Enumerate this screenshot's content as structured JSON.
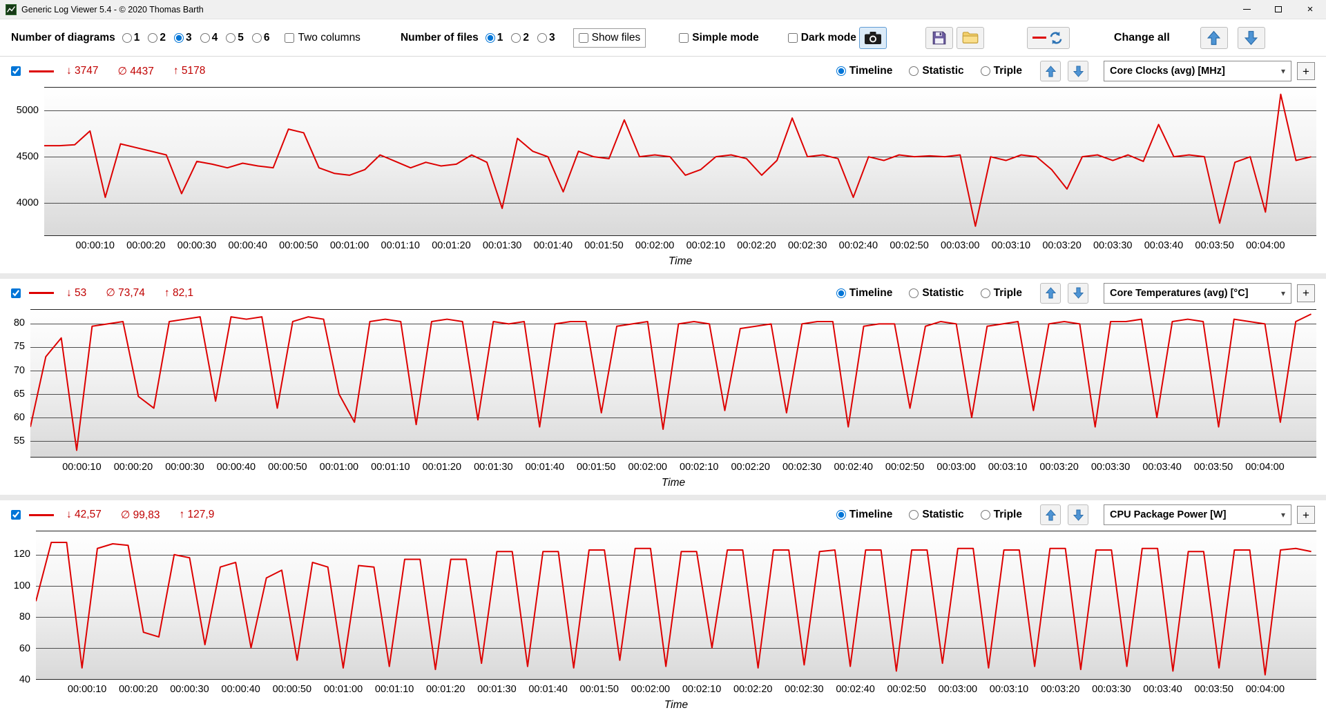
{
  "window": {
    "title": "Generic Log Viewer 5.4 - © 2020 Thomas Barth"
  },
  "toolbar": {
    "diagrams_label": "Number of diagrams",
    "diagram_options": [
      "1",
      "2",
      "3",
      "4",
      "5",
      "6"
    ],
    "diagrams_selected": "3",
    "two_columns_label": "Two columns",
    "two_columns_checked": false,
    "files_label": "Number of files",
    "file_options": [
      "1",
      "2",
      "3"
    ],
    "files_selected": "1",
    "show_files_label": "Show files",
    "show_files_checked": false,
    "simple_mode_label": "Simple mode",
    "simple_mode_checked": false,
    "dark_mode_label": "Dark mode",
    "dark_mode_checked": false,
    "change_all_label": "Change all"
  },
  "panels": [
    {
      "enabled": true,
      "min": "↓ 3747",
      "avg": "∅ 4437",
      "max": "↑ 5178",
      "views": {
        "timeline": "Timeline",
        "statistic": "Statistic",
        "triple": "Triple"
      },
      "selected_view": "Timeline",
      "metric": "Core Clocks (avg) [MHz]",
      "plus": "+",
      "xlabel": "Time"
    },
    {
      "enabled": true,
      "min": "↓ 53",
      "avg": "∅ 73,74",
      "max": "↑ 82,1",
      "views": {
        "timeline": "Timeline",
        "statistic": "Statistic",
        "triple": "Triple"
      },
      "selected_view": "Timeline",
      "metric": "Core Temperatures (avg) [°C]",
      "plus": "+",
      "xlabel": "Time"
    },
    {
      "enabled": true,
      "min": "↓ 42,57",
      "avg": "∅ 99,83",
      "max": "↑ 127,9",
      "views": {
        "timeline": "Timeline",
        "statistic": "Statistic",
        "triple": "Triple"
      },
      "selected_view": "Timeline",
      "metric": "CPU Package Power [W]",
      "plus": "+",
      "xlabel": "Time"
    }
  ],
  "chart_data": [
    {
      "type": "line",
      "title": "Core Clocks (avg) [MHz]",
      "xlabel": "Time",
      "x_start": 0,
      "x_step": 3,
      "x_max": 250,
      "x_tick_step": 10,
      "x_ticks": [
        "00:00:10",
        "00:00:20",
        "00:00:30",
        "00:00:40",
        "00:00:50",
        "00:01:00",
        "00:01:10",
        "00:01:20",
        "00:01:30",
        "00:01:40",
        "00:01:50",
        "00:02:00",
        "00:02:10",
        "00:02:20",
        "00:02:30",
        "00:02:40",
        "00:02:50",
        "00:03:00",
        "00:03:10",
        "00:03:20",
        "00:03:30",
        "00:03:40",
        "00:03:50",
        "00:04:00"
      ],
      "y_ticks": [
        4000,
        4500,
        5000
      ],
      "ylim": [
        3650,
        5250
      ],
      "grid": true,
      "series": [
        {
          "name": "Core Clocks (avg) [MHz]",
          "color": "#dd0000",
          "values": [
            4620,
            4620,
            4630,
            4780,
            4060,
            4640,
            4600,
            4560,
            4520,
            4100,
            4450,
            4420,
            4380,
            4430,
            4400,
            4380,
            4800,
            4760,
            4380,
            4320,
            4300,
            4360,
            4520,
            4450,
            4380,
            4440,
            4400,
            4420,
            4520,
            4440,
            3940,
            4700,
            4560,
            4500,
            4120,
            4560,
            4500,
            4480,
            4900,
            4500,
            4520,
            4500,
            4300,
            4360,
            4500,
            4520,
            4480,
            4300,
            4460,
            4920,
            4500,
            4520,
            4480,
            4060,
            4500,
            4460,
            4520,
            4500,
            4510,
            4500,
            4520,
            3747,
            4500,
            4460,
            4520,
            4500,
            4360,
            4150,
            4500,
            4520,
            4460,
            4520,
            4450,
            4850,
            4500,
            4520,
            4500,
            3780,
            4440,
            4500,
            3900,
            5178,
            4460,
            4500
          ]
        }
      ]
    },
    {
      "type": "line",
      "title": "Core Temperatures (avg) [°C]",
      "xlabel": "Time",
      "x_start": 0,
      "x_step": 3,
      "x_max": 250,
      "x_tick_step": 10,
      "x_ticks": [
        "00:00:10",
        "00:00:20",
        "00:00:30",
        "00:00:40",
        "00:00:50",
        "00:01:00",
        "00:01:10",
        "00:01:20",
        "00:01:30",
        "00:01:40",
        "00:01:50",
        "00:02:00",
        "00:02:10",
        "00:02:20",
        "00:02:30",
        "00:02:40",
        "00:02:50",
        "00:03:00",
        "00:03:10",
        "00:03:20",
        "00:03:30",
        "00:03:40",
        "00:03:50",
        "00:04:00"
      ],
      "y_ticks": [
        55,
        60,
        65,
        70,
        75,
        80
      ],
      "ylim": [
        51.5,
        83
      ],
      "grid": true,
      "series": [
        {
          "name": "Core Temperatures (avg) [°C]",
          "color": "#dd0000",
          "values": [
            58,
            73,
            77,
            53,
            79.5,
            80,
            80.5,
            64.5,
            62,
            80.5,
            81,
            81.5,
            63.5,
            81.5,
            81,
            81.5,
            62,
            80.5,
            81.5,
            81,
            65,
            59,
            80.5,
            81,
            80.5,
            58.5,
            80.5,
            81,
            80.5,
            59.5,
            80.5,
            80,
            80.5,
            58,
            80,
            80.5,
            80.5,
            61,
            79.5,
            80,
            80.5,
            57.5,
            80,
            80.5,
            80,
            61.5,
            79,
            79.5,
            80,
            61,
            80,
            80.5,
            80.5,
            58,
            79.5,
            80,
            80,
            62,
            79.5,
            80.5,
            80,
            60,
            79.5,
            80,
            80.5,
            61.5,
            80,
            80.5,
            80,
            58,
            80.5,
            80.5,
            81,
            60,
            80.5,
            81,
            80.5,
            58,
            81,
            80.5,
            80,
            59,
            80.5,
            82.1
          ]
        }
      ]
    },
    {
      "type": "line",
      "title": "CPU Package Power [W]",
      "xlabel": "Time",
      "x_start": 0,
      "x_step": 3,
      "x_max": 250,
      "x_tick_step": 10,
      "x_ticks": [
        "00:00:10",
        "00:00:20",
        "00:00:30",
        "00:00:40",
        "00:00:50",
        "00:01:00",
        "00:01:10",
        "00:01:20",
        "00:01:30",
        "00:01:40",
        "00:01:50",
        "00:02:00",
        "00:02:10",
        "00:02:20",
        "00:02:30",
        "00:02:40",
        "00:02:50",
        "00:03:00",
        "00:03:10",
        "00:03:20",
        "00:03:30",
        "00:03:40",
        "00:03:50",
        "00:04:00"
      ],
      "y_ticks": [
        40,
        60,
        80,
        100,
        120
      ],
      "ylim": [
        40,
        135
      ],
      "grid": true,
      "series": [
        {
          "name": "CPU Package Power [W]",
          "color": "#dd0000",
          "values": [
            90,
            127.9,
            127.9,
            47,
            124,
            127,
            126,
            70,
            67,
            120,
            118,
            62,
            112,
            115,
            60,
            105,
            110,
            52,
            115,
            112,
            47,
            113,
            112,
            48,
            117,
            117,
            46,
            117,
            117,
            50,
            122,
            122,
            48,
            122,
            122,
            47,
            123,
            123,
            52,
            124,
            124,
            48,
            122,
            122,
            60,
            123,
            123,
            47,
            123,
            123,
            49,
            122,
            123,
            48,
            123,
            123,
            45,
            123,
            123,
            50,
            124,
            124,
            47,
            123,
            123,
            48,
            124,
            124,
            46,
            123,
            123,
            48,
            124,
            124,
            45,
            122,
            122,
            47,
            123,
            123,
            42.57,
            123,
            124,
            122
          ]
        }
      ]
    }
  ]
}
